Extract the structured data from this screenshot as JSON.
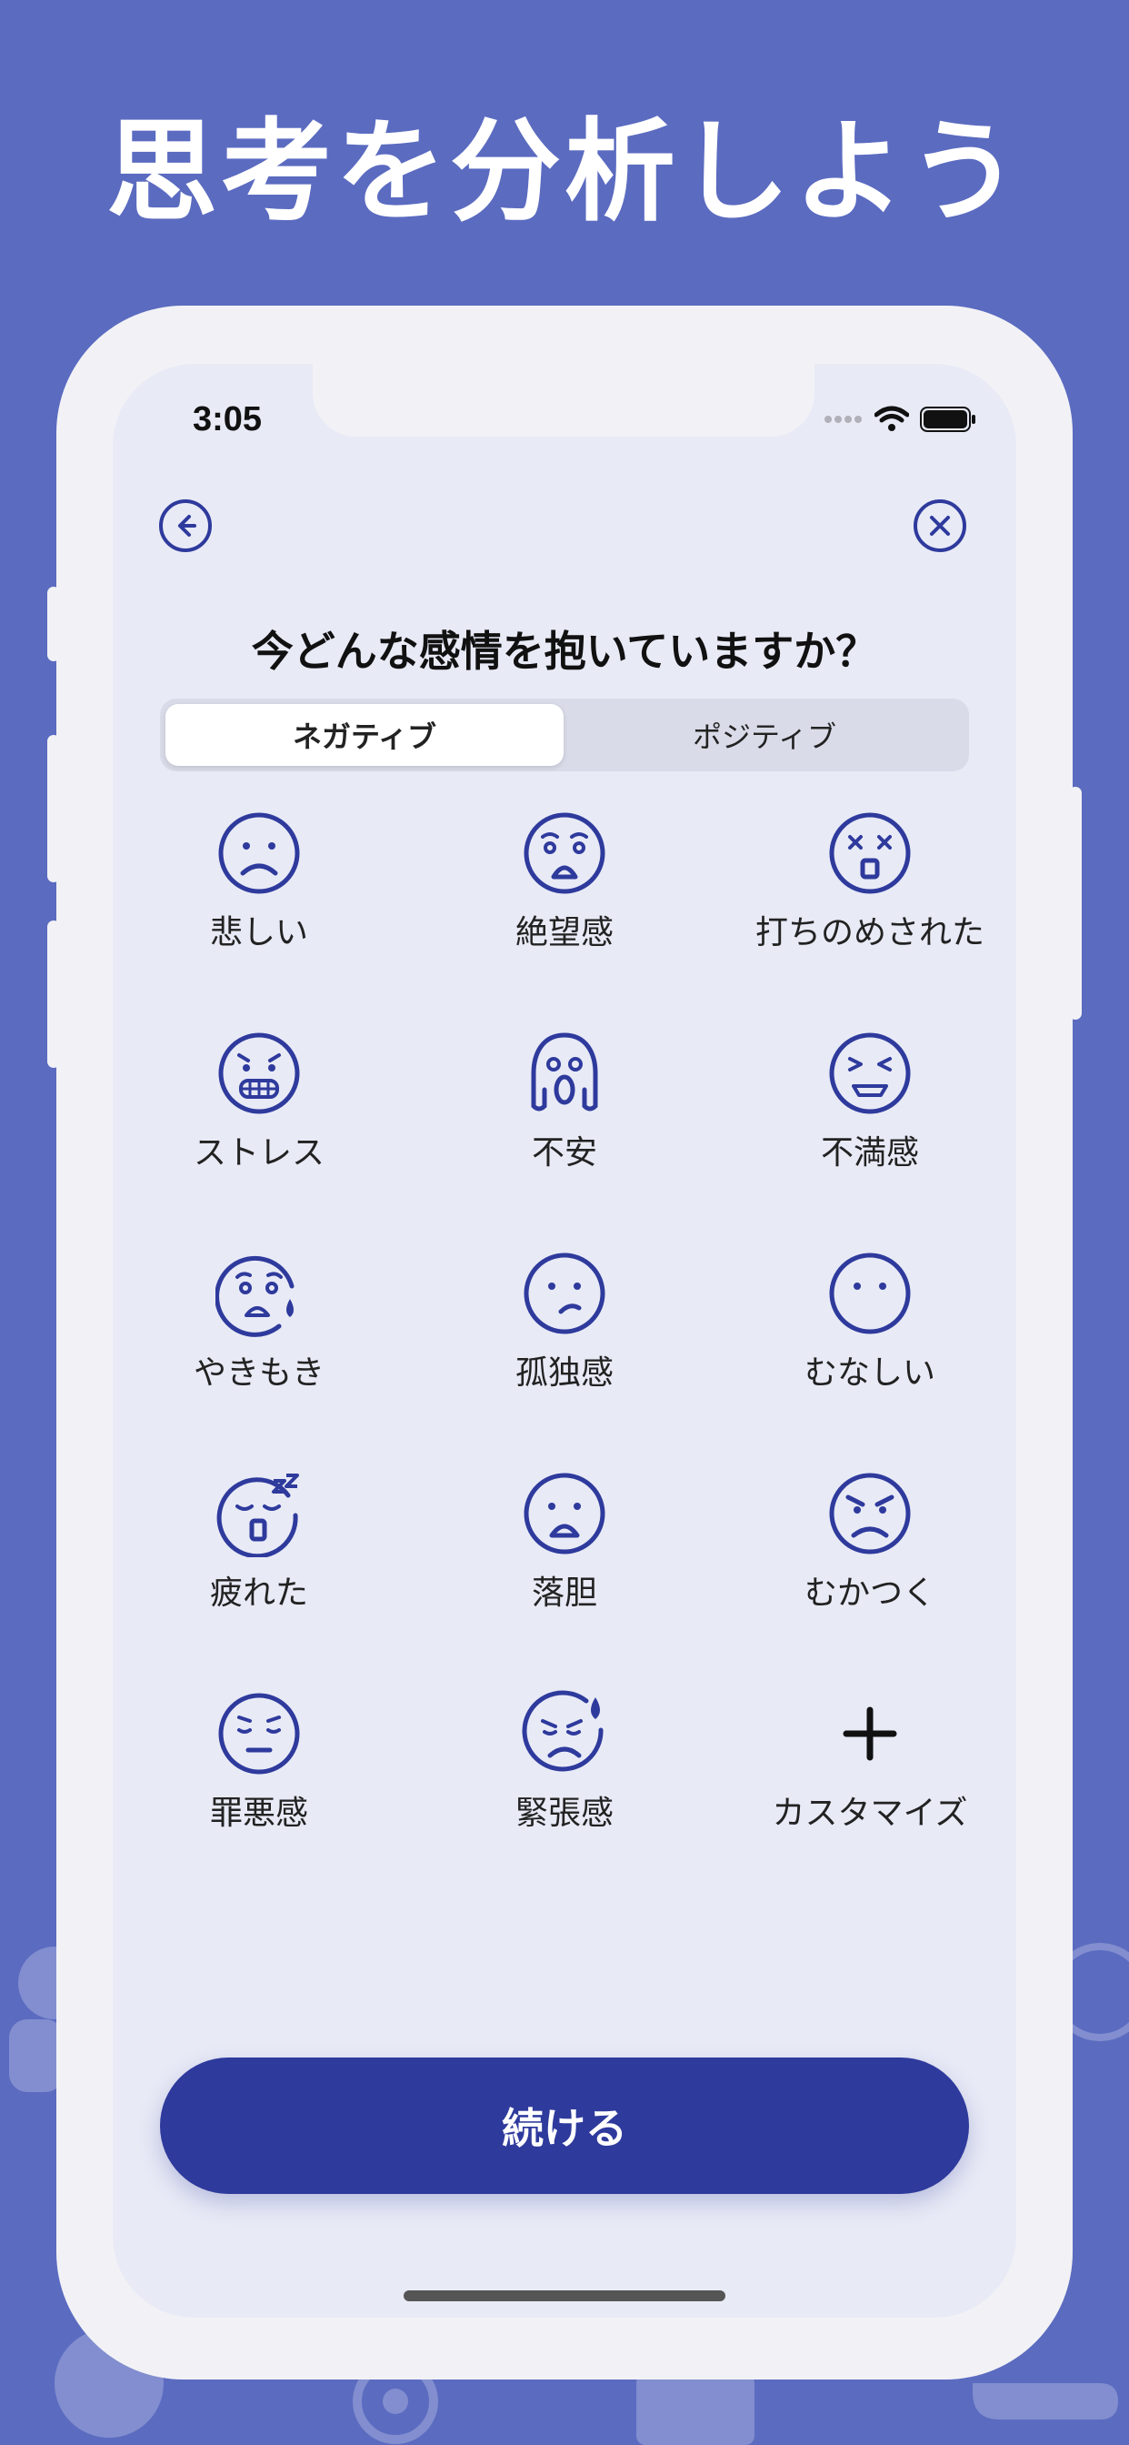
{
  "headline": "思考を分析しよう",
  "status": {
    "time": "3:05"
  },
  "nav": {
    "back_icon": "arrow-left-circle-icon",
    "close_icon": "close-circle-icon"
  },
  "question": "今どんな感情を抱いていますか？",
  "tabs": [
    {
      "label": "ネガティブ",
      "selected": true
    },
    {
      "label": "ポジティブ",
      "selected": false
    }
  ],
  "emotions": [
    {
      "label": "悲しい",
      "icon": "sad-face-icon"
    },
    {
      "label": "絶望感",
      "icon": "anguished-face-icon"
    },
    {
      "label": "打ちのめされた",
      "icon": "dizzy-face-icon"
    },
    {
      "label": "ストレス",
      "icon": "grimacing-face-icon"
    },
    {
      "label": "不安",
      "icon": "screaming-face-icon"
    },
    {
      "label": "不満感",
      "icon": "tired-face-icon"
    },
    {
      "label": "やきもき",
      "icon": "anxious-sweat-face-icon"
    },
    {
      "label": "孤独感",
      "icon": "confused-face-icon"
    },
    {
      "label": "むなしい",
      "icon": "neutral-face-icon"
    },
    {
      "label": "疲れた",
      "icon": "sleepy-face-icon"
    },
    {
      "label": "落胆",
      "icon": "frowning-open-mouth-icon"
    },
    {
      "label": "むかつく",
      "icon": "angry-face-icon"
    },
    {
      "label": "罪悪感",
      "icon": "pensive-face-icon"
    },
    {
      "label": "緊張感",
      "icon": "nervous-sweat-face-icon"
    },
    {
      "label": "カスタマイズ",
      "icon": "plus-icon"
    }
  ],
  "continue_label": "続ける",
  "colors": {
    "background": "#5b6bc0",
    "accent": "#2e3a9c",
    "icon": "#2e3a9c"
  }
}
